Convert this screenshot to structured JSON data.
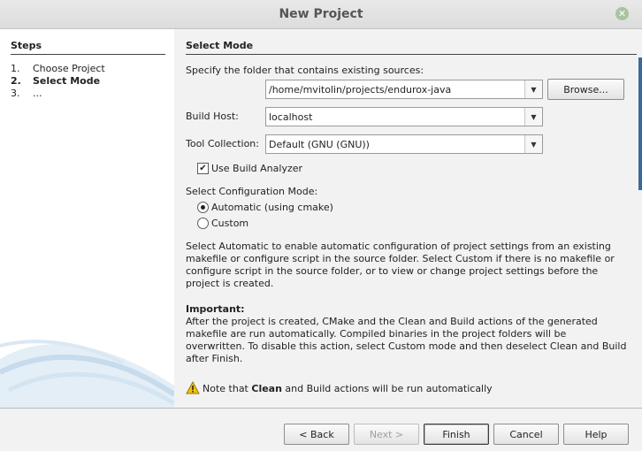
{
  "window": {
    "title": "New Project"
  },
  "steps": {
    "heading": "Steps",
    "items": [
      {
        "num": "1.",
        "label": "Choose Project",
        "active": false
      },
      {
        "num": "2.",
        "label": "Select Mode",
        "active": true
      },
      {
        "num": "3.",
        "label": "...",
        "active": false
      }
    ]
  },
  "main": {
    "title": "Select Mode",
    "folder_label": "Specify the folder that contains existing sources:",
    "folder_value": "/home/mvitolin/projects/endurox-java",
    "browse_label": "Browse...",
    "build_host_label": "Build Host:",
    "build_host_value": "localhost",
    "tool_collection_label": "Tool Collection:",
    "tool_collection_value": "Default (GNU (GNU))",
    "use_build_analyzer_label": "Use Build Analyzer",
    "use_build_analyzer_checked": true,
    "config_mode_label": "Select Configuration Mode:",
    "mode_automatic_label": "Automatic (using cmake)",
    "mode_custom_label": "Custom",
    "selected_mode": "automatic",
    "description": "Select Automatic to enable automatic configuration of project settings from an existing makefile or configure script in the source folder. Select Custom if there is no makefile or configure script in the source folder, or to view or change project settings before the project is created.",
    "important_heading": "Important:",
    "important_text": "After the project is created, CMake and the Clean and Build actions of the generated makefile are run automatically. Compiled binaries in the project folders will be overwritten. To disable this action, select Custom mode and then deselect Clean and Build after Finish.",
    "note_prefix": "Note that ",
    "note_bold": "Clean",
    "note_suffix": " and Build actions will be run automatically"
  },
  "footer": {
    "back_label": "< Back",
    "next_label": "Next >",
    "finish_label": "Finish",
    "cancel_label": "Cancel",
    "help_label": "Help"
  },
  "icons": {
    "close": "close-icon",
    "warning": "warning-icon",
    "dropdown": "chevron-down-icon",
    "check": "checkmark-icon"
  },
  "colors": {
    "accent": "#3b6a98",
    "warning": "#f3c012",
    "close": "#a9c3a0"
  }
}
